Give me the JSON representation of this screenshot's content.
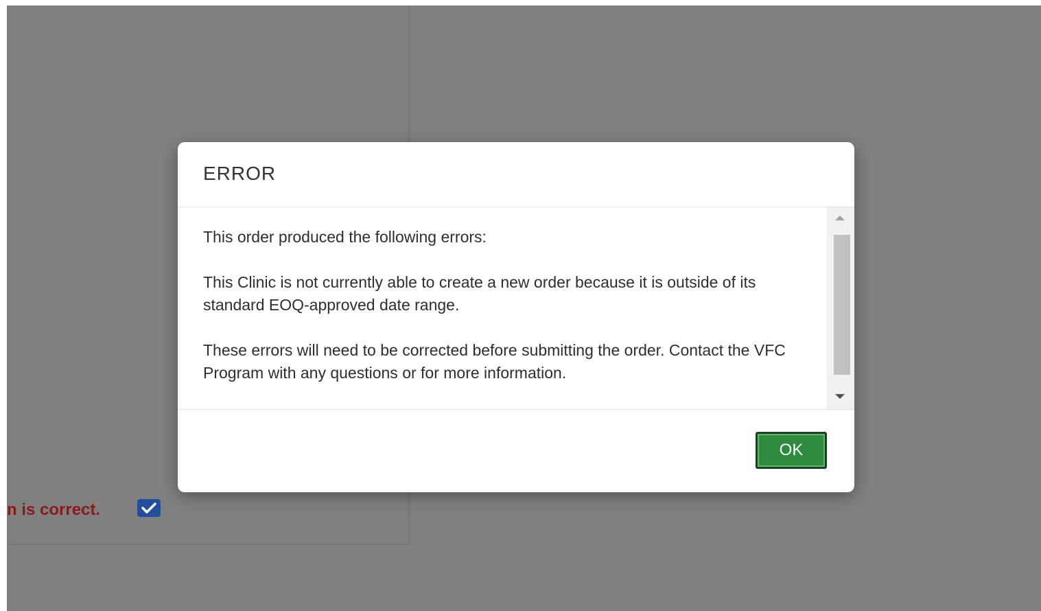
{
  "background": {
    "confirm_text": "n is correct.",
    "checkbox_checked": true,
    "overlay_color": "#808080"
  },
  "dialog": {
    "title": "ERROR",
    "intro": "This order produced the following errors:",
    "error_message": "This Clinic is not currently able to create a new order because it is outside of its standard EOQ-approved date range.",
    "footer_note": "These errors will need to be corrected before submitting the order. Contact the VFC Program with any questions or for more information.",
    "ok_label": "OK",
    "ok_color": "#2e8b3e"
  }
}
